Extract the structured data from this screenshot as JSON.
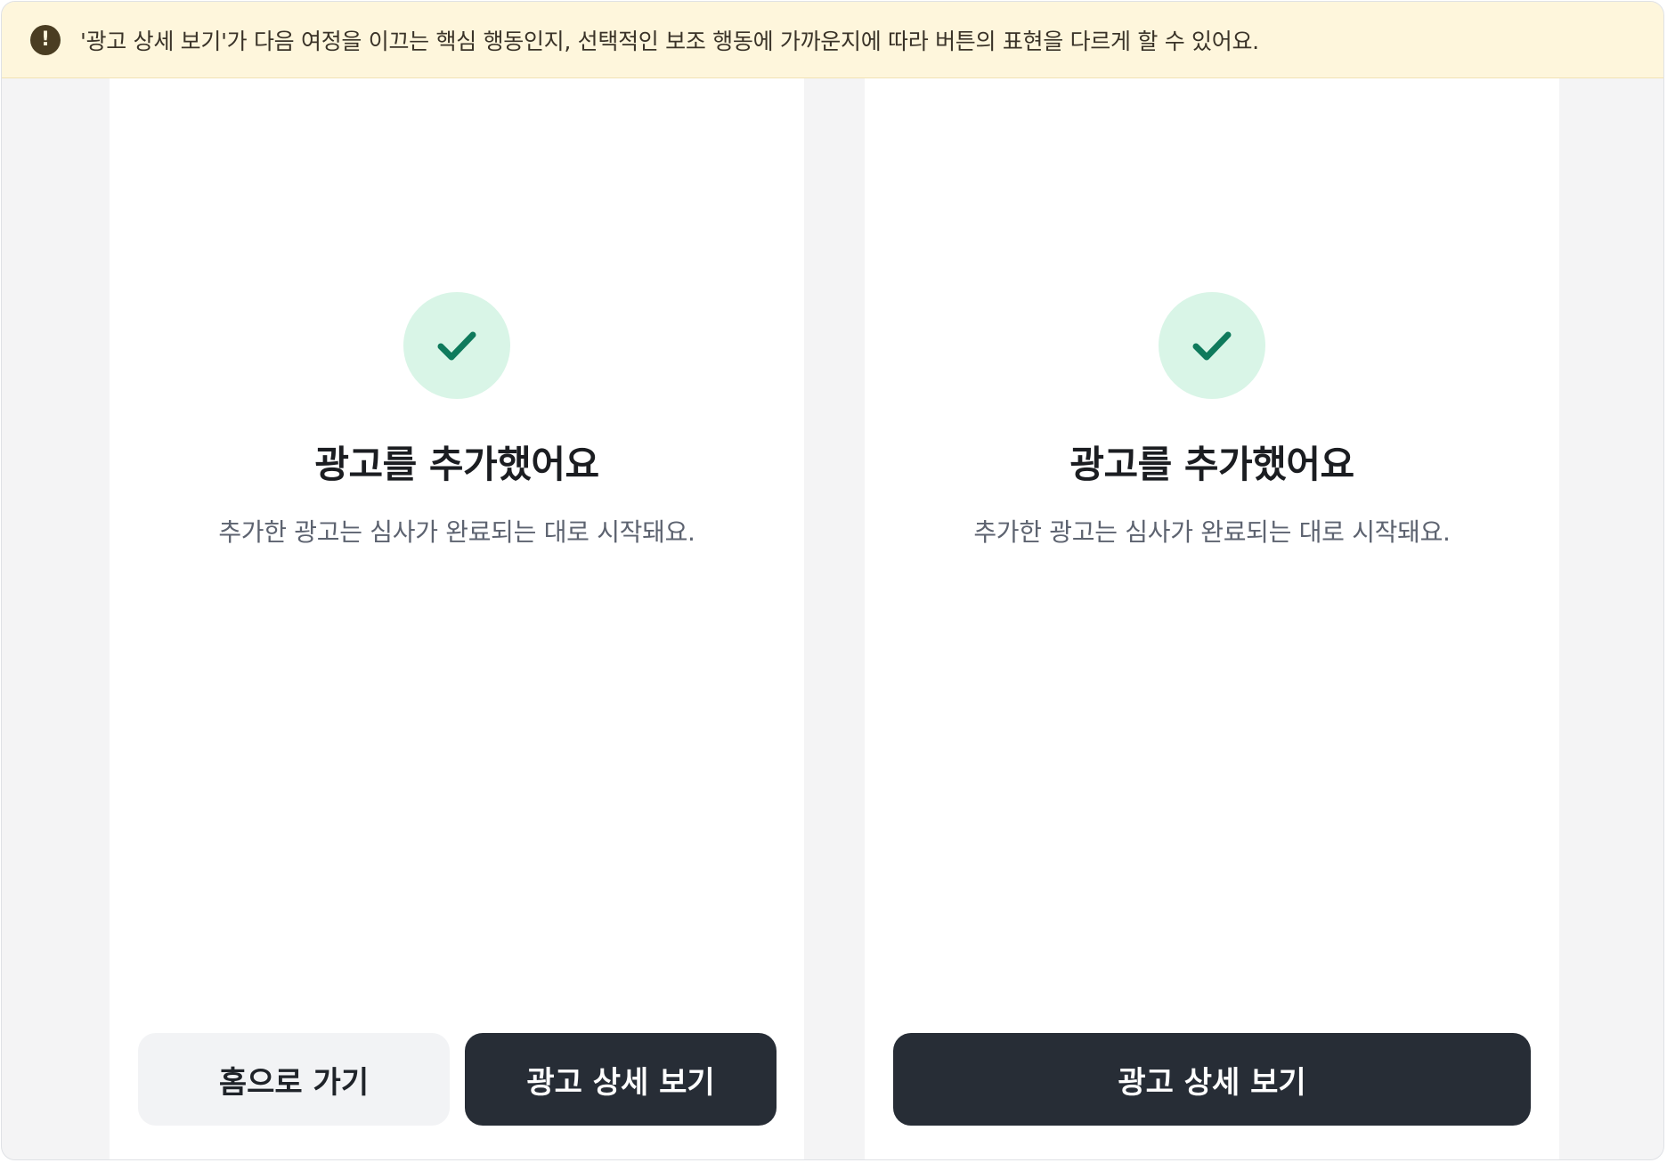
{
  "notice": {
    "icon": "exclamation-circle-icon",
    "text": "'광고 상세 보기'가 다음 여정을 이끄는 핵심 행동인지, 선택적인 보조 행동에 가까운지에 따라 버튼의 표현을 다르게 할 수 있어요.",
    "background_color": "#fef6dc"
  },
  "panels": [
    {
      "icon": "check-icon",
      "title": "광고를 추가했어요",
      "subtitle": "추가한 광고는 심사가 완료되는 대로 시작돼요.",
      "buttons": [
        {
          "label": "홈으로 가기",
          "style": "secondary"
        },
        {
          "label": "광고 상세 보기",
          "style": "primary"
        }
      ]
    },
    {
      "icon": "check-icon",
      "title": "광고를 추가했어요",
      "subtitle": "추가한 광고는 심사가 완료되는 대로 시작돼요.",
      "buttons": [
        {
          "label": "광고 상세 보기",
          "style": "primary"
        }
      ]
    }
  ],
  "colors": {
    "accent_check": "#0f7a5c",
    "check_bg": "#d9f5e7",
    "primary_button": "#272d36",
    "secondary_button": "#f2f3f5"
  }
}
